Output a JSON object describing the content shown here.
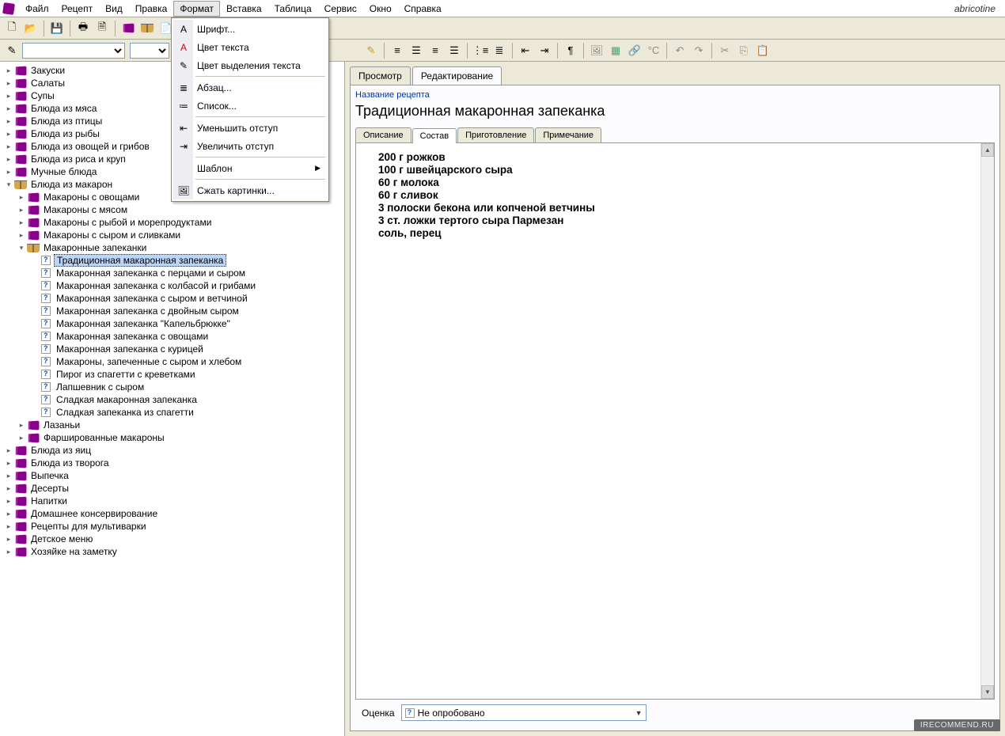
{
  "brand": "abricotine",
  "menubar": [
    "Файл",
    "Рецепт",
    "Вид",
    "Правка",
    "Формат",
    "Вставка",
    "Таблица",
    "Сервис",
    "Окно",
    "Справка"
  ],
  "open_menu_index": 4,
  "dropdown": {
    "items": [
      {
        "icon": "A",
        "label": "Шрифт..."
      },
      {
        "icon": "A",
        "color": "#c00",
        "label": "Цвет текста"
      },
      {
        "icon": "✎",
        "label": "Цвет выделения текста"
      },
      {
        "sep": true
      },
      {
        "icon": "≣",
        "label": "Абзац..."
      },
      {
        "icon": "≔",
        "label": "Список..."
      },
      {
        "sep": true
      },
      {
        "icon": "⇤",
        "label": "Уменьшить отступ"
      },
      {
        "icon": "⇥",
        "label": "Увеличить отступ"
      },
      {
        "sep": true
      },
      {
        "icon": "",
        "label": "Шаблон",
        "submenu": true
      },
      {
        "sep": true
      },
      {
        "icon": "🖼",
        "label": "Сжать картинки..."
      }
    ]
  },
  "tree": [
    {
      "lvl": 0,
      "type": "book",
      "arrow": "▸",
      "label": "Закуски"
    },
    {
      "lvl": 0,
      "type": "book",
      "arrow": "▸",
      "label": "Салаты"
    },
    {
      "lvl": 0,
      "type": "book",
      "arrow": "▸",
      "label": "Супы"
    },
    {
      "lvl": 0,
      "type": "book",
      "arrow": "▸",
      "label": "Блюда из мяса"
    },
    {
      "lvl": 0,
      "type": "book",
      "arrow": "▸",
      "label": "Блюда из птицы"
    },
    {
      "lvl": 0,
      "type": "book",
      "arrow": "▸",
      "label": "Блюда из рыбы"
    },
    {
      "lvl": 0,
      "type": "book",
      "arrow": "▸",
      "label": "Блюда из овощей и грибов"
    },
    {
      "lvl": 0,
      "type": "book",
      "arrow": "▸",
      "label": "Блюда из риса и круп"
    },
    {
      "lvl": 0,
      "type": "book",
      "arrow": "▸",
      "label": "Мучные блюда"
    },
    {
      "lvl": 0,
      "type": "open",
      "arrow": "▾",
      "label": "Блюда из макарон"
    },
    {
      "lvl": 1,
      "type": "book",
      "arrow": "▸",
      "label": "Макароны с овощами"
    },
    {
      "lvl": 1,
      "type": "book",
      "arrow": "▸",
      "label": "Макароны с мясом"
    },
    {
      "lvl": 1,
      "type": "book",
      "arrow": "▸",
      "label": "Макароны с рыбой и морепродуктами"
    },
    {
      "lvl": 1,
      "type": "book",
      "arrow": "▸",
      "label": "Макароны с сыром и сливками"
    },
    {
      "lvl": 1,
      "type": "open",
      "arrow": "▾",
      "label": "Макаронные запеканки"
    },
    {
      "lvl": 2,
      "type": "page",
      "arrow": "",
      "label": "Традиционная макаронная запеканка",
      "selected": true
    },
    {
      "lvl": 2,
      "type": "page",
      "arrow": "",
      "label": "Макаронная запеканка с перцами и сыром"
    },
    {
      "lvl": 2,
      "type": "page",
      "arrow": "",
      "label": "Макаронная запеканка с колбасой и грибами"
    },
    {
      "lvl": 2,
      "type": "page",
      "arrow": "",
      "label": "Макаронная запеканка с сыром и ветчиной"
    },
    {
      "lvl": 2,
      "type": "page",
      "arrow": "",
      "label": "Макаронная запеканка с двойным сыром"
    },
    {
      "lvl": 2,
      "type": "page",
      "arrow": "",
      "label": "Макаронная запеканка \"Капельбрюкке\""
    },
    {
      "lvl": 2,
      "type": "page",
      "arrow": "",
      "label": "Макаронная запеканка с овощами"
    },
    {
      "lvl": 2,
      "type": "page",
      "arrow": "",
      "label": "Макаронная запеканка с курицей"
    },
    {
      "lvl": 2,
      "type": "page",
      "arrow": "",
      "label": "Макароны, запеченные с сыром и хлебом"
    },
    {
      "lvl": 2,
      "type": "page",
      "arrow": "",
      "label": "Пирог из спагетти с креветками"
    },
    {
      "lvl": 2,
      "type": "page",
      "arrow": "",
      "label": "Лапшевник с сыром"
    },
    {
      "lvl": 2,
      "type": "page",
      "arrow": "",
      "label": "Сладкая макаронная запеканка"
    },
    {
      "lvl": 2,
      "type": "page",
      "arrow": "",
      "label": "Сладкая запеканка из спагетти"
    },
    {
      "lvl": 1,
      "type": "book",
      "arrow": "▸",
      "label": "Лазаньи"
    },
    {
      "lvl": 1,
      "type": "book",
      "arrow": "▸",
      "label": "Фаршированные макароны"
    },
    {
      "lvl": 0,
      "type": "book",
      "arrow": "▸",
      "label": "Блюда из яиц"
    },
    {
      "lvl": 0,
      "type": "book",
      "arrow": "▸",
      "label": "Блюда из творога"
    },
    {
      "lvl": 0,
      "type": "book",
      "arrow": "▸",
      "label": "Выпечка"
    },
    {
      "lvl": 0,
      "type": "book",
      "arrow": "▸",
      "label": "Десерты"
    },
    {
      "lvl": 0,
      "type": "book",
      "arrow": "▸",
      "label": "Напитки"
    },
    {
      "lvl": 0,
      "type": "book",
      "arrow": "▸",
      "label": "Домашнее консервирование"
    },
    {
      "lvl": 0,
      "type": "book",
      "arrow": "▸",
      "label": "Рецепты для мультиварки"
    },
    {
      "lvl": 0,
      "type": "book",
      "arrow": "▸",
      "label": "Детское меню"
    },
    {
      "lvl": 0,
      "type": "book",
      "arrow": "▸",
      "label": "Хозяйке на заметку"
    }
  ],
  "view_tabs": [
    "Просмотр",
    "Редактирование"
  ],
  "active_view_tab": 1,
  "recipe": {
    "title_label": "Название рецепта",
    "title": "Традиционная макаронная запеканка",
    "sub_tabs": [
      "Описание",
      "Состав",
      "Приготовление",
      "Примечание"
    ],
    "active_sub_tab": 1,
    "ingredients": [
      "200 г рожков",
      "100 г швейцарского сыра",
      "60 г молока",
      "60 г сливок",
      "3 полоски бекона или копченой ветчины",
      "3 ст. ложки тертого сыра Пармезан",
      "соль, перец"
    ],
    "rating_label": "Оценка",
    "rating_value": "Не опробовано"
  },
  "watermark": "IRECOMMEND.RU"
}
